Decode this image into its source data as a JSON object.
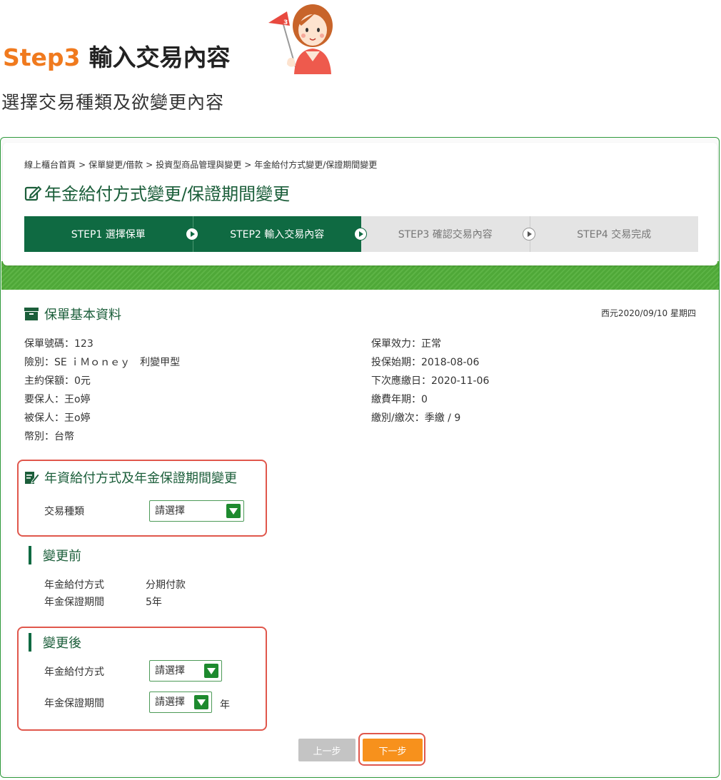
{
  "header": {
    "step_label": "Step3",
    "step_text": "輸入交易內容",
    "subtitle": "選擇交易種類及欲變更內容"
  },
  "breadcrumb": [
    "線上櫃台首頁",
    "保單變更/借款",
    "投資型商品管理與變更",
    "年金給付方式變更/保證期間變更"
  ],
  "breadcrumb_separator": ">",
  "page_title": "年金給付方式變更/保證期間變更",
  "steps": [
    {
      "label": "STEP1 選擇保單",
      "state": "done"
    },
    {
      "label": "STEP2 輸入交易內容",
      "state": "current"
    },
    {
      "label": "STEP3 確認交易內容",
      "state": "pending"
    },
    {
      "label": "STEP4 交易完成",
      "state": "pending"
    }
  ],
  "policy": {
    "section_title": "保單基本資料",
    "date": "西元2020/09/10 星期四",
    "left": [
      "保單號碼：123",
      "險別：SE ｉＭｏｎｅｙ　利變甲型",
      "主約保額：0元",
      "要保人：王o婷",
      "被保人：王o婷",
      "幣別：台幣"
    ],
    "right": [
      "保單效力：正常",
      "投保始期：2018-08-06",
      "下次應繳日：2020-11-06",
      "繳費年期：0",
      "繳別/繳次：季繳 /  9"
    ]
  },
  "change_section": {
    "title": "年資給付方式及年金保證期間變更",
    "type_label": "交易種類",
    "type_select": "請選擇"
  },
  "before": {
    "title": "變更前",
    "rows": [
      {
        "label": "年金給付方式",
        "value": "分期付款"
      },
      {
        "label": "年金保證期間",
        "value": "5年"
      }
    ]
  },
  "after": {
    "title": "變更後",
    "method_label": "年金給付方式",
    "method_select": "請選擇",
    "period_label": "年金保證期間",
    "period_select": "請選擇",
    "period_unit": "年"
  },
  "buttons": {
    "prev": "上一步",
    "next": "下一步"
  },
  "mascot_flag_number": "3",
  "colors": {
    "brand_green": "#0f6a42",
    "accent_orange": "#f7911c",
    "highlight_red": "#e0574c",
    "step_orange": "#f07a1e"
  }
}
